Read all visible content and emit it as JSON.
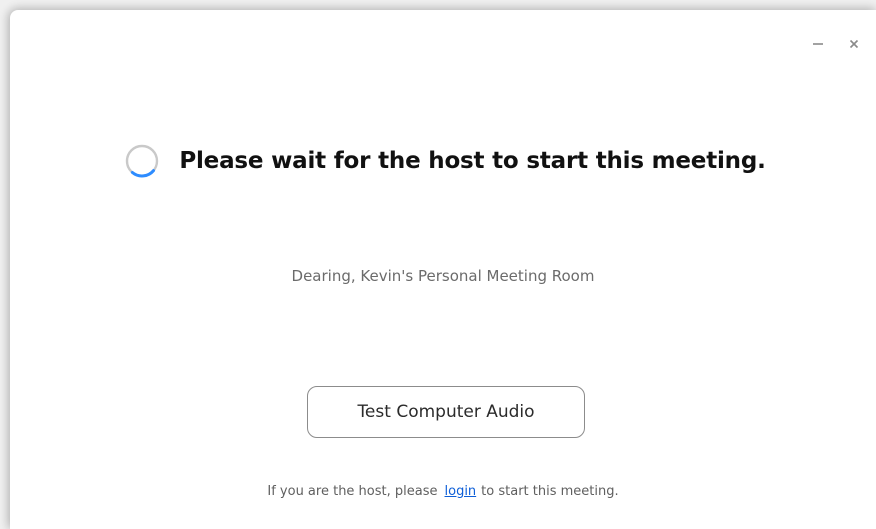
{
  "window": {
    "minimize_icon": "minimize-icon",
    "close_icon": "close-icon"
  },
  "main": {
    "spinner_icon": "loading-spinner-icon",
    "headline": "Please wait for the host to start this meeting.",
    "room_name": "Dearing, Kevin's Personal Meeting Room",
    "test_audio_button": "Test Computer Audio",
    "host_note": {
      "before": "If you are the host, please",
      "link": "login",
      "after": "to start this meeting."
    }
  },
  "colors": {
    "spinner_track": "#c9c9c9",
    "spinner_accent": "#2d8cff",
    "link": "#0e5fd8"
  }
}
